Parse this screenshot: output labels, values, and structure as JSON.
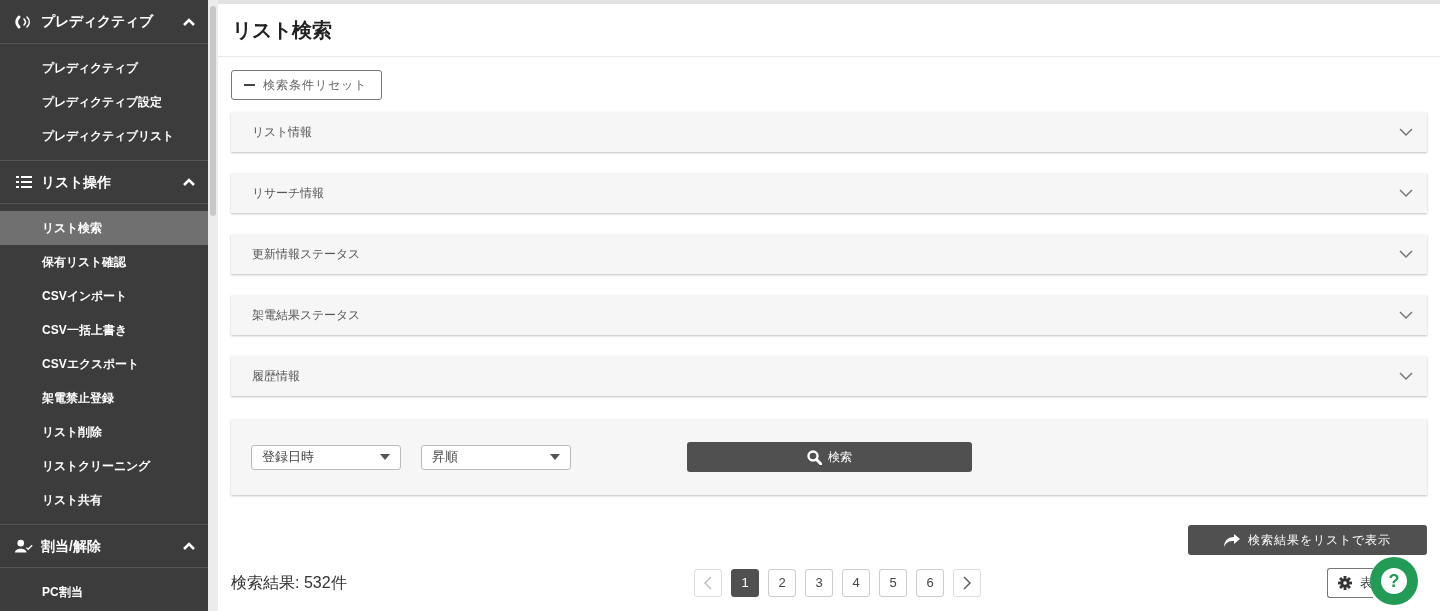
{
  "sidebar": {
    "groups": [
      {
        "title": "プレディクティブ",
        "expanded": true,
        "items": [
          {
            "label": "プレディクティブ",
            "selected": false
          },
          {
            "label": "プレディクティブ設定",
            "selected": false
          },
          {
            "label": "プレディクティブリスト",
            "selected": false
          }
        ]
      },
      {
        "title": "リスト操作",
        "expanded": true,
        "items": [
          {
            "label": "リスト検索",
            "selected": true
          },
          {
            "label": "保有リスト確認",
            "selected": false
          },
          {
            "label": "CSVインポート",
            "selected": false
          },
          {
            "label": "CSV一括上書き",
            "selected": false
          },
          {
            "label": "CSVエクスポート",
            "selected": false
          },
          {
            "label": "架電禁止登録",
            "selected": false
          },
          {
            "label": "リスト削除",
            "selected": false
          },
          {
            "label": "リストクリーニング",
            "selected": false
          },
          {
            "label": "リスト共有",
            "selected": false
          }
        ]
      },
      {
        "title": "割当/解除",
        "expanded": true,
        "items": [
          {
            "label": "PC割当",
            "selected": false
          }
        ]
      }
    ]
  },
  "page_title": "リスト検索",
  "reset_button": "検索条件リセット",
  "sections": [
    {
      "label": "リスト情報",
      "expanded": false
    },
    {
      "label": "リサーチ情報",
      "expanded": false
    },
    {
      "label": "更新情報ステータス",
      "expanded": false
    },
    {
      "label": "架電結果ステータス",
      "expanded": false
    },
    {
      "label": "履歴情報",
      "expanded": false
    }
  ],
  "sort": {
    "field": "登録日時",
    "order": "昇順",
    "search_button": "検索"
  },
  "show_list_button": "検索結果をリストで表示",
  "result_count": "検索結果: 532件",
  "pagination": {
    "pages": [
      {
        "label": "1",
        "selected": true
      },
      {
        "label": "2",
        "selected": false
      },
      {
        "label": "3",
        "selected": false
      },
      {
        "label": "4",
        "selected": false
      },
      {
        "label": "5",
        "selected": false
      },
      {
        "label": "6",
        "selected": false
      }
    ]
  },
  "display_button": "表",
  "help_button": "?"
}
